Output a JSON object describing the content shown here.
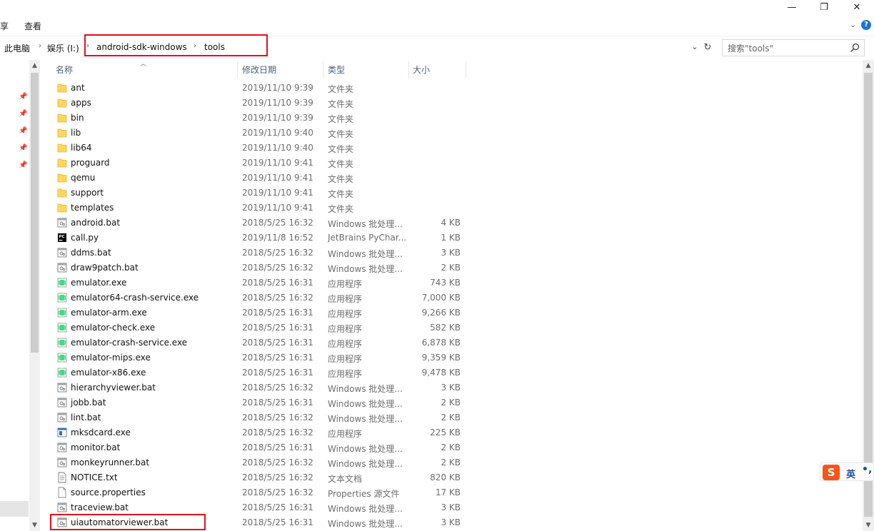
{
  "ribbon": {
    "share_tab": "享",
    "view_tab": "查看"
  },
  "window_controls": {
    "minimize": "—",
    "restore": "❐",
    "close": "✕"
  },
  "address": {
    "crumbs": [
      "此电脑",
      "娱乐 (I:)",
      "android-sdk-windows",
      "tools"
    ],
    "separator": "›"
  },
  "search": {
    "placeholder": "搜索\"tools\""
  },
  "columns": {
    "name": "名称",
    "date": "修改日期",
    "type": "类型",
    "size": "大小"
  },
  "files": [
    {
      "name": "ant",
      "date": "2019/11/10 9:39",
      "type": "文件夹",
      "size": "",
      "icon": "folder-icon"
    },
    {
      "name": "apps",
      "date": "2019/11/10 9:39",
      "type": "文件夹",
      "size": "",
      "icon": "folder-icon"
    },
    {
      "name": "bin",
      "date": "2019/11/10 9:39",
      "type": "文件夹",
      "size": "",
      "icon": "folder-icon"
    },
    {
      "name": "lib",
      "date": "2019/11/10 9:40",
      "type": "文件夹",
      "size": "",
      "icon": "folder-icon"
    },
    {
      "name": "lib64",
      "date": "2019/11/10 9:40",
      "type": "文件夹",
      "size": "",
      "icon": "folder-icon"
    },
    {
      "name": "proguard",
      "date": "2019/11/10 9:41",
      "type": "文件夹",
      "size": "",
      "icon": "folder-icon"
    },
    {
      "name": "qemu",
      "date": "2019/11/10 9:41",
      "type": "文件夹",
      "size": "",
      "icon": "folder-icon"
    },
    {
      "name": "support",
      "date": "2019/11/10 9:41",
      "type": "文件夹",
      "size": "",
      "icon": "folder-icon"
    },
    {
      "name": "templates",
      "date": "2019/11/10 9:41",
      "type": "文件夹",
      "size": "",
      "icon": "folder-icon"
    },
    {
      "name": "android.bat",
      "date": "2018/5/25 16:32",
      "type": "Windows 批处理...",
      "size": "4 KB",
      "icon": "batch-file-icon"
    },
    {
      "name": "call.py",
      "date": "2019/11/8 16:52",
      "type": "JetBrains PyChar...",
      "size": "1 KB",
      "icon": "pycharm-file-icon"
    },
    {
      "name": "ddms.bat",
      "date": "2018/5/25 16:32",
      "type": "Windows 批处理...",
      "size": "3 KB",
      "icon": "batch-file-icon"
    },
    {
      "name": "draw9patch.bat",
      "date": "2018/5/25 16:32",
      "type": "Windows 批处理...",
      "size": "2 KB",
      "icon": "batch-file-icon"
    },
    {
      "name": "emulator.exe",
      "date": "2018/5/25 16:31",
      "type": "应用程序",
      "size": "743 KB",
      "icon": "android-exe-icon"
    },
    {
      "name": "emulator64-crash-service.exe",
      "date": "2018/5/25 16:32",
      "type": "应用程序",
      "size": "7,000 KB",
      "icon": "android-exe-icon"
    },
    {
      "name": "emulator-arm.exe",
      "date": "2018/5/25 16:31",
      "type": "应用程序",
      "size": "9,266 KB",
      "icon": "android-exe-icon"
    },
    {
      "name": "emulator-check.exe",
      "date": "2018/5/25 16:31",
      "type": "应用程序",
      "size": "582 KB",
      "icon": "android-exe-icon"
    },
    {
      "name": "emulator-crash-service.exe",
      "date": "2018/5/25 16:31",
      "type": "应用程序",
      "size": "6,878 KB",
      "icon": "android-exe-icon"
    },
    {
      "name": "emulator-mips.exe",
      "date": "2018/5/25 16:31",
      "type": "应用程序",
      "size": "9,359 KB",
      "icon": "android-exe-icon"
    },
    {
      "name": "emulator-x86.exe",
      "date": "2018/5/25 16:31",
      "type": "应用程序",
      "size": "9,478 KB",
      "icon": "android-exe-icon"
    },
    {
      "name": "hierarchyviewer.bat",
      "date": "2018/5/25 16:32",
      "type": "Windows 批处理...",
      "size": "3 KB",
      "icon": "batch-file-icon"
    },
    {
      "name": "jobb.bat",
      "date": "2018/5/25 16:31",
      "type": "Windows 批处理...",
      "size": "2 KB",
      "icon": "batch-file-icon"
    },
    {
      "name": "lint.bat",
      "date": "2018/5/25 16:32",
      "type": "Windows 批处理...",
      "size": "2 KB",
      "icon": "batch-file-icon"
    },
    {
      "name": "mksdcard.exe",
      "date": "2018/5/25 16:32",
      "type": "应用程序",
      "size": "225 KB",
      "icon": "exe-window-icon"
    },
    {
      "name": "monitor.bat",
      "date": "2018/5/25 16:31",
      "type": "Windows 批处理...",
      "size": "2 KB",
      "icon": "batch-file-icon"
    },
    {
      "name": "monkeyrunner.bat",
      "date": "2018/5/25 16:32",
      "type": "Windows 批处理...",
      "size": "2 KB",
      "icon": "batch-file-icon"
    },
    {
      "name": "NOTICE.txt",
      "date": "2018/5/25 16:32",
      "type": "文本文档",
      "size": "820 KB",
      "icon": "text-file-icon"
    },
    {
      "name": "source.properties",
      "date": "2018/5/25 16:32",
      "type": "Properties 源文件",
      "size": "17 KB",
      "icon": "blank-file-icon"
    },
    {
      "name": "traceview.bat",
      "date": "2018/5/25 16:31",
      "type": "Windows 批处理...",
      "size": "3 KB",
      "icon": "batch-file-icon"
    },
    {
      "name": "uiautomatorviewer.bat",
      "date": "2018/5/25 16:31",
      "type": "Windows 批处理...",
      "size": "3 KB",
      "icon": "batch-file-icon"
    }
  ],
  "ime": {
    "logo": "S",
    "lang": "英",
    "punct": "•,"
  },
  "colors": {
    "highlight_box": "#e0111b",
    "folder": "#ffd75e",
    "android_green": "#3ddc84",
    "header_text": "#4c607a"
  }
}
